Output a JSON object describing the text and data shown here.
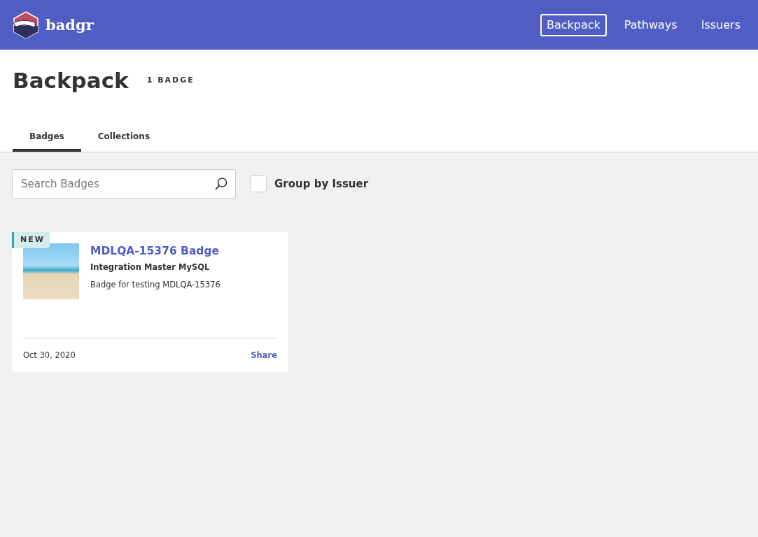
{
  "brand": {
    "name": "badgr"
  },
  "nav": [
    {
      "label": "Backpack",
      "selected": true
    },
    {
      "label": "Pathways",
      "selected": false
    },
    {
      "label": "Issuers",
      "selected": false
    }
  ],
  "page": {
    "title": "Backpack",
    "count": "1 BADGE"
  },
  "tabs": [
    {
      "label": "Badges",
      "selected": true
    },
    {
      "label": "Collections",
      "selected": false
    }
  ],
  "search": {
    "placeholder": "Search Badges"
  },
  "group_by_issuer": {
    "label": "Group by Issuer",
    "checked": false
  },
  "badges": [
    {
      "new_label": "NEW",
      "title": "MDLQA-15376 Badge",
      "issuer": "Integration Master MySQL",
      "description": "Badge for testing MDLQA-15376",
      "date": "Oct 30, 2020",
      "action": "Share"
    }
  ]
}
